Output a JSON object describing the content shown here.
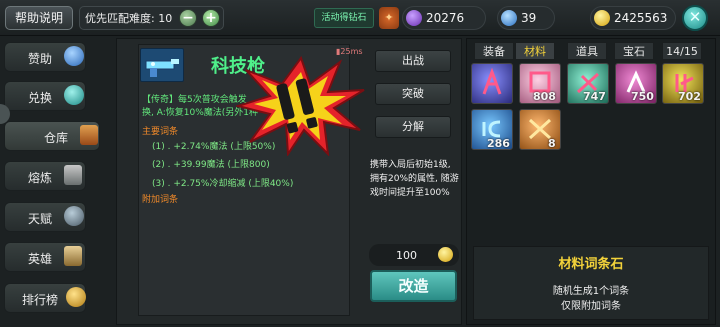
{
  "header": {
    "help_label": "帮助说明",
    "difficulty_label": "优先匹配难度: 10",
    "minus_symbol": "−",
    "plus_symbol": "+",
    "event_label": "活动得钻石",
    "currencies": [
      {
        "name": "purple-gem",
        "value": "20276",
        "color": "#8a4cc9"
      },
      {
        "name": "blue-gem",
        "value": "39",
        "color": "#3c8ee0"
      },
      {
        "name": "gold-coin",
        "value": "2425563",
        "color": "#e2b318"
      }
    ],
    "close_symbol": "✕"
  },
  "sidebar": {
    "items": [
      {
        "label": "赞助"
      },
      {
        "label": "兑换"
      },
      {
        "label": "仓库",
        "active": true
      },
      {
        "label": "熔炼"
      },
      {
        "label": "天赋"
      },
      {
        "label": "英雄"
      },
      {
        "label": "排行榜"
      }
    ]
  },
  "item": {
    "name": "科技枪",
    "ping": "25ms",
    "legend_line1": "【传奇】每5次普攻会触发",
    "legend_line2": "换, A:恢复10%魔法(另外1种",
    "main_affix_title": "主要词条",
    "affixes": [
      "(1) . +2.74%魔法 (上限50%)",
      "(2) . +39.99魔法 (上限800)",
      "(3) . +2.75%冷却缩减 (上限40%)"
    ],
    "extra_affix_title": "附加词条"
  },
  "actions": {
    "deploy": "出战",
    "breakthrough": "突破",
    "dismantle": "分解",
    "carry_desc": "携带入局后初始1级, 拥有20%的属性, 随游戏时间提升至100%",
    "cost": "100",
    "reforge": "改造"
  },
  "inventory": {
    "tabs": [
      "装备",
      "材料",
      "道具",
      "宝石",
      "14/15"
    ],
    "active_tab": "材料",
    "slots": [
      {
        "name": "blue-rune",
        "count": "",
        "color": "#4a4fae"
      },
      {
        "name": "pink-rune",
        "count": "808",
        "color": "#c47a9e"
      },
      {
        "name": "green-rune",
        "count": "747",
        "color": "#2f9a7d"
      },
      {
        "name": "magenta-rune",
        "count": "750",
        "color": "#b04a8e"
      },
      {
        "name": "yellow-rune",
        "count": "702",
        "color": "#b09a1a"
      },
      {
        "name": "cyan-rune",
        "count": "286",
        "color": "#2a6ab0"
      },
      {
        "name": "orange-scroll",
        "count": "8",
        "color": "#d0802a"
      }
    ]
  },
  "info": {
    "title": "材料词条石",
    "line1": "随机生成1个词条",
    "line2": "仅限附加词条"
  }
}
